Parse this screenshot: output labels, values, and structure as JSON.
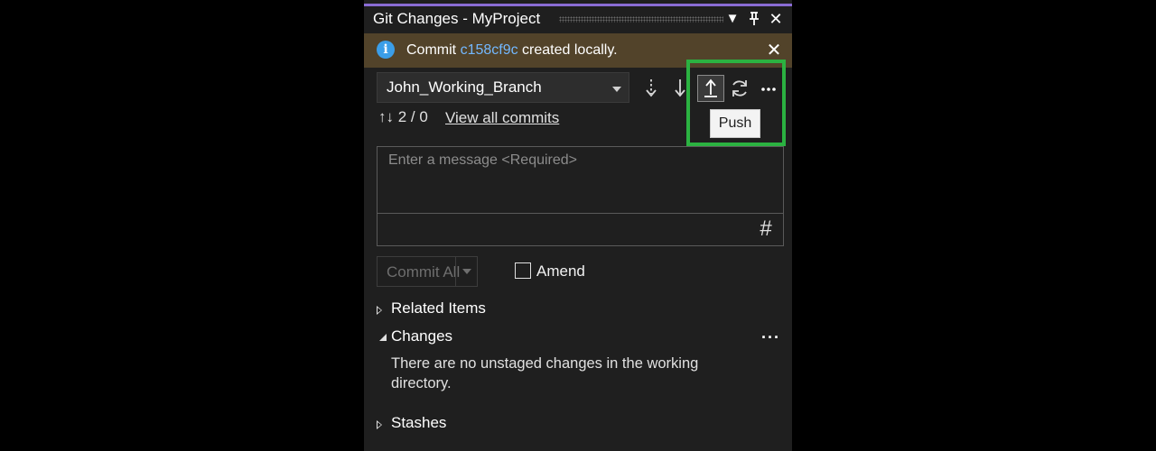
{
  "window": {
    "title": "Git Changes - MyProject",
    "dropdown_icon": "triangle-down-icon",
    "pin_icon": "pin-icon",
    "close_icon": "close-icon"
  },
  "infobar": {
    "icon": "info-icon",
    "prefix": "Commit ",
    "commit_link": "c158cf9c",
    "suffix": " created locally.",
    "close_icon": "close-icon"
  },
  "branch": {
    "selected": "John_Working_Branch"
  },
  "toolbar": {
    "fetch_icon": "fetch-icon",
    "pull_icon": "pull-icon",
    "push_icon": "push-icon",
    "sync_icon": "sync-icon",
    "more_icon": "more-icon",
    "push_tooltip": "Push"
  },
  "commits": {
    "counts": "↑↓ 2 / 0",
    "view_all": "View all commits"
  },
  "message": {
    "placeholder": "Enter a message <Required>",
    "value": "",
    "hash_label": "#"
  },
  "commit_bar": {
    "commit_all_label": "Commit All",
    "amend_label": "Amend",
    "amend_checked": false
  },
  "sections": {
    "related_items": "Related Items",
    "changes": "Changes",
    "changes_message": "There are no unstaged changes in the working directory.",
    "stashes": "Stashes",
    "more_label": "···"
  },
  "colors": {
    "highlight": "#2bb241",
    "link": "#73b8ff",
    "infobar_bg": "#52432a",
    "panel_bg": "#1f1f1f"
  }
}
